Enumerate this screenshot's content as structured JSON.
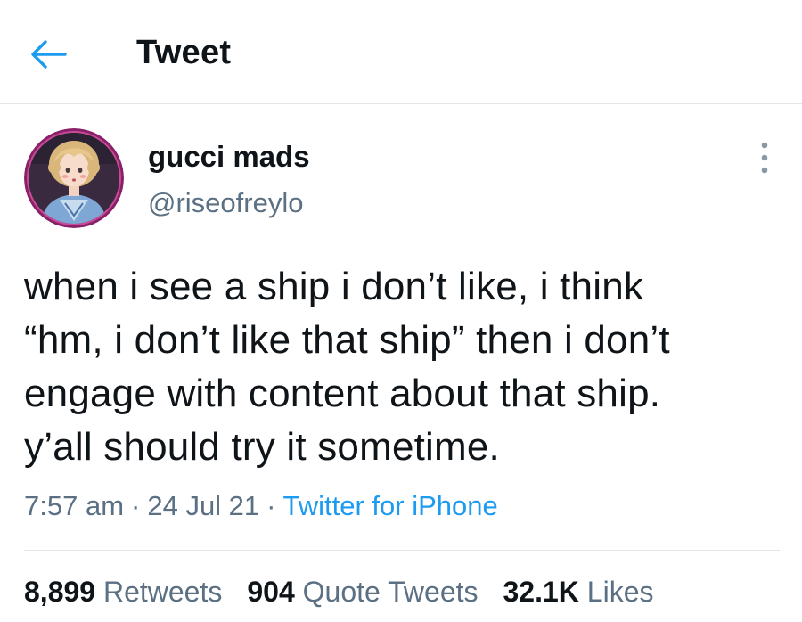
{
  "header": {
    "title": "Tweet",
    "back_icon": "arrow-left-icon",
    "accent_color": "#1d9bf0"
  },
  "author": {
    "display_name": "gucci mads",
    "handle": "@riseofreylo",
    "avatar_icon": "avatar-illustration"
  },
  "tweet": {
    "lines": [
      "when i see a ship i don’t like, i think",
      "“hm, i don’t like that ship” then i don’t",
      "engage with content about that ship.",
      "y’all should try it sometime."
    ],
    "time": "7:57 am",
    "date": "24 Jul 21",
    "separator": "·",
    "source": "Twitter for iPhone"
  },
  "stats": {
    "retweets_count": "8,899",
    "retweets_label": "Retweets",
    "quotes_count": "904",
    "quotes_label": "Quote Tweets",
    "likes_count": "32.1K",
    "likes_label": "Likes"
  },
  "colors": {
    "text_primary": "#0f1419",
    "text_secondary": "#5b7083",
    "link": "#1d9bf0",
    "border": "#e1e6ea"
  }
}
